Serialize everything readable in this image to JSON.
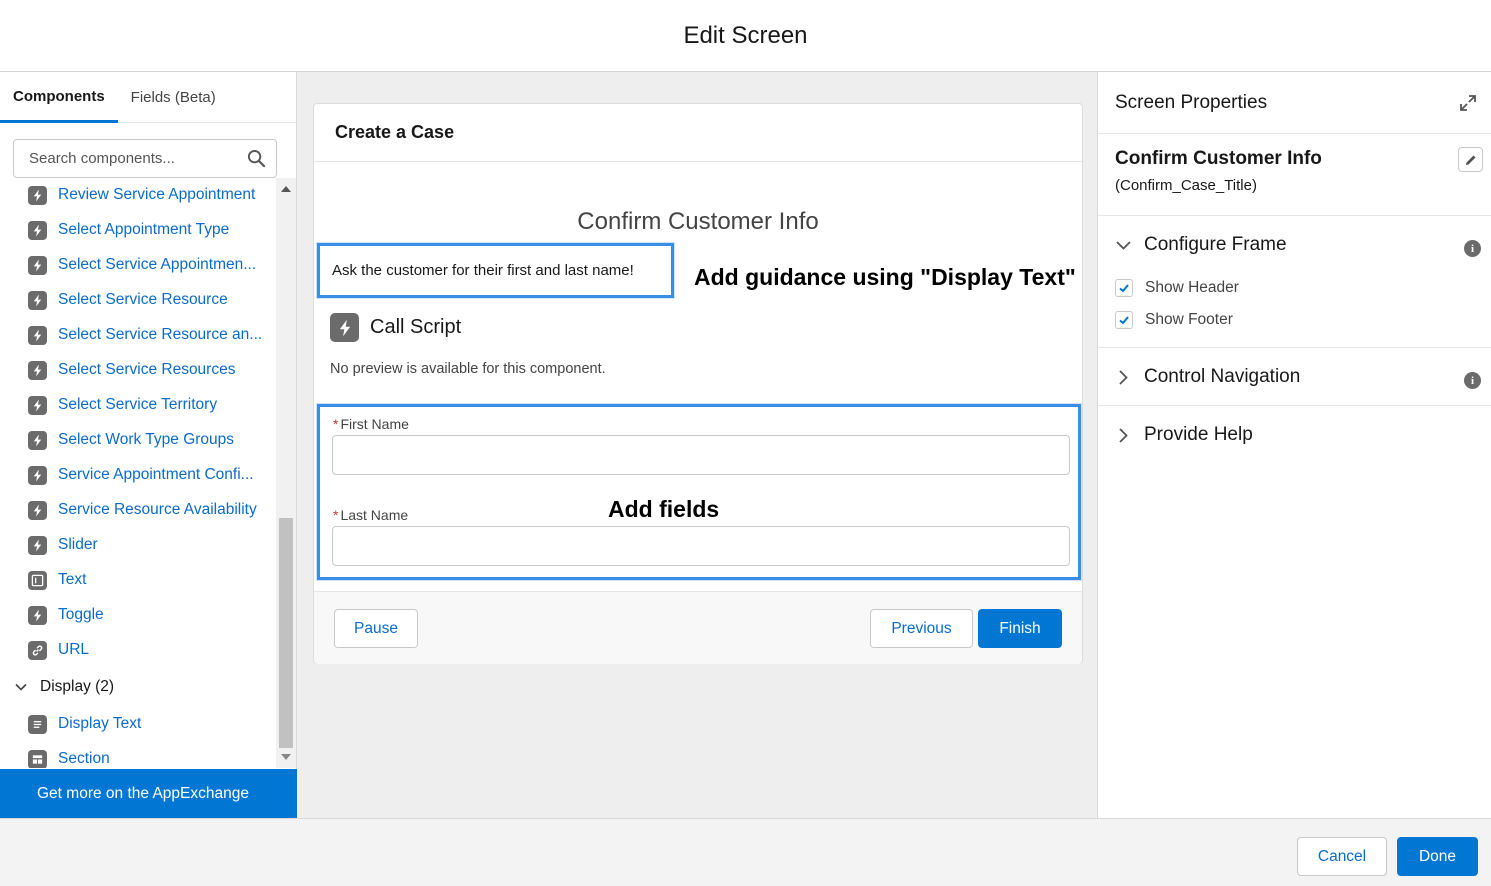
{
  "header": {
    "title": "Edit Screen"
  },
  "left_panel": {
    "tabs": [
      {
        "label": "Components",
        "active": true
      },
      {
        "label": "Fields (Beta)",
        "active": false
      }
    ],
    "search": {
      "placeholder": "Search components..."
    },
    "items": [
      {
        "label": "Review Service Appointment",
        "icon": "lightning-icon"
      },
      {
        "label": "Select Appointment Type",
        "icon": "lightning-icon"
      },
      {
        "label": "Select Service Appointmen...",
        "icon": "lightning-icon"
      },
      {
        "label": "Select Service Resource",
        "icon": "lightning-icon"
      },
      {
        "label": "Select Service Resource an...",
        "icon": "lightning-icon"
      },
      {
        "label": "Select Service Resources",
        "icon": "lightning-icon"
      },
      {
        "label": "Select Service Territory",
        "icon": "lightning-icon"
      },
      {
        "label": "Select Work Type Groups",
        "icon": "lightning-icon"
      },
      {
        "label": "Service Appointment Confi...",
        "icon": "lightning-icon"
      },
      {
        "label": "Service Resource Availability",
        "icon": "lightning-icon"
      },
      {
        "label": "Slider",
        "icon": "lightning-icon"
      },
      {
        "label": "Text",
        "icon": "text-input-icon"
      },
      {
        "label": "Toggle",
        "icon": "lightning-icon"
      },
      {
        "label": "URL",
        "icon": "link-icon"
      }
    ],
    "display_group": {
      "label": "Display (2)",
      "items": [
        {
          "label": "Display Text",
          "icon": "display-text-icon"
        },
        {
          "label": "Section",
          "icon": "section-icon"
        }
      ]
    },
    "appexchange_label": "Get more on the AppExchange"
  },
  "canvas": {
    "card_title": "Create a Case",
    "screen_title": "Confirm Customer Info",
    "display_text": "Ask the customer for their first and last name!",
    "annotation_guidance": "Add guidance using \"Display Text\"",
    "call_script": "Call Script",
    "no_preview": "No preview is available for this component.",
    "fields": [
      {
        "label": "First Name",
        "required": true,
        "value": ""
      },
      {
        "label": "Last Name",
        "required": true,
        "value": ""
      }
    ],
    "required_mark": "*",
    "annotation_fields": "Add fields",
    "buttons": {
      "pause": "Pause",
      "previous": "Previous",
      "finish": "Finish"
    }
  },
  "right_panel": {
    "title": "Screen Properties",
    "screen_label": "Confirm Customer Info",
    "screen_api_name": "(Confirm_Case_Title)",
    "sections": {
      "configure_frame": {
        "label": "Configure Frame",
        "expanded": true
      },
      "control_navigation": {
        "label": "Control Navigation",
        "expanded": false
      },
      "provide_help": {
        "label": "Provide Help",
        "expanded": false
      }
    },
    "checkboxes": [
      {
        "label": "Show Header",
        "checked": true
      },
      {
        "label": "Show Footer",
        "checked": true
      }
    ],
    "info_glyph": "i"
  },
  "footer": {
    "cancel": "Cancel",
    "done": "Done"
  },
  "colors": {
    "brand": "#0176d3",
    "link": "#0b6bcb",
    "annotation_border": "#3b8ee8",
    "required": "#c23934"
  }
}
